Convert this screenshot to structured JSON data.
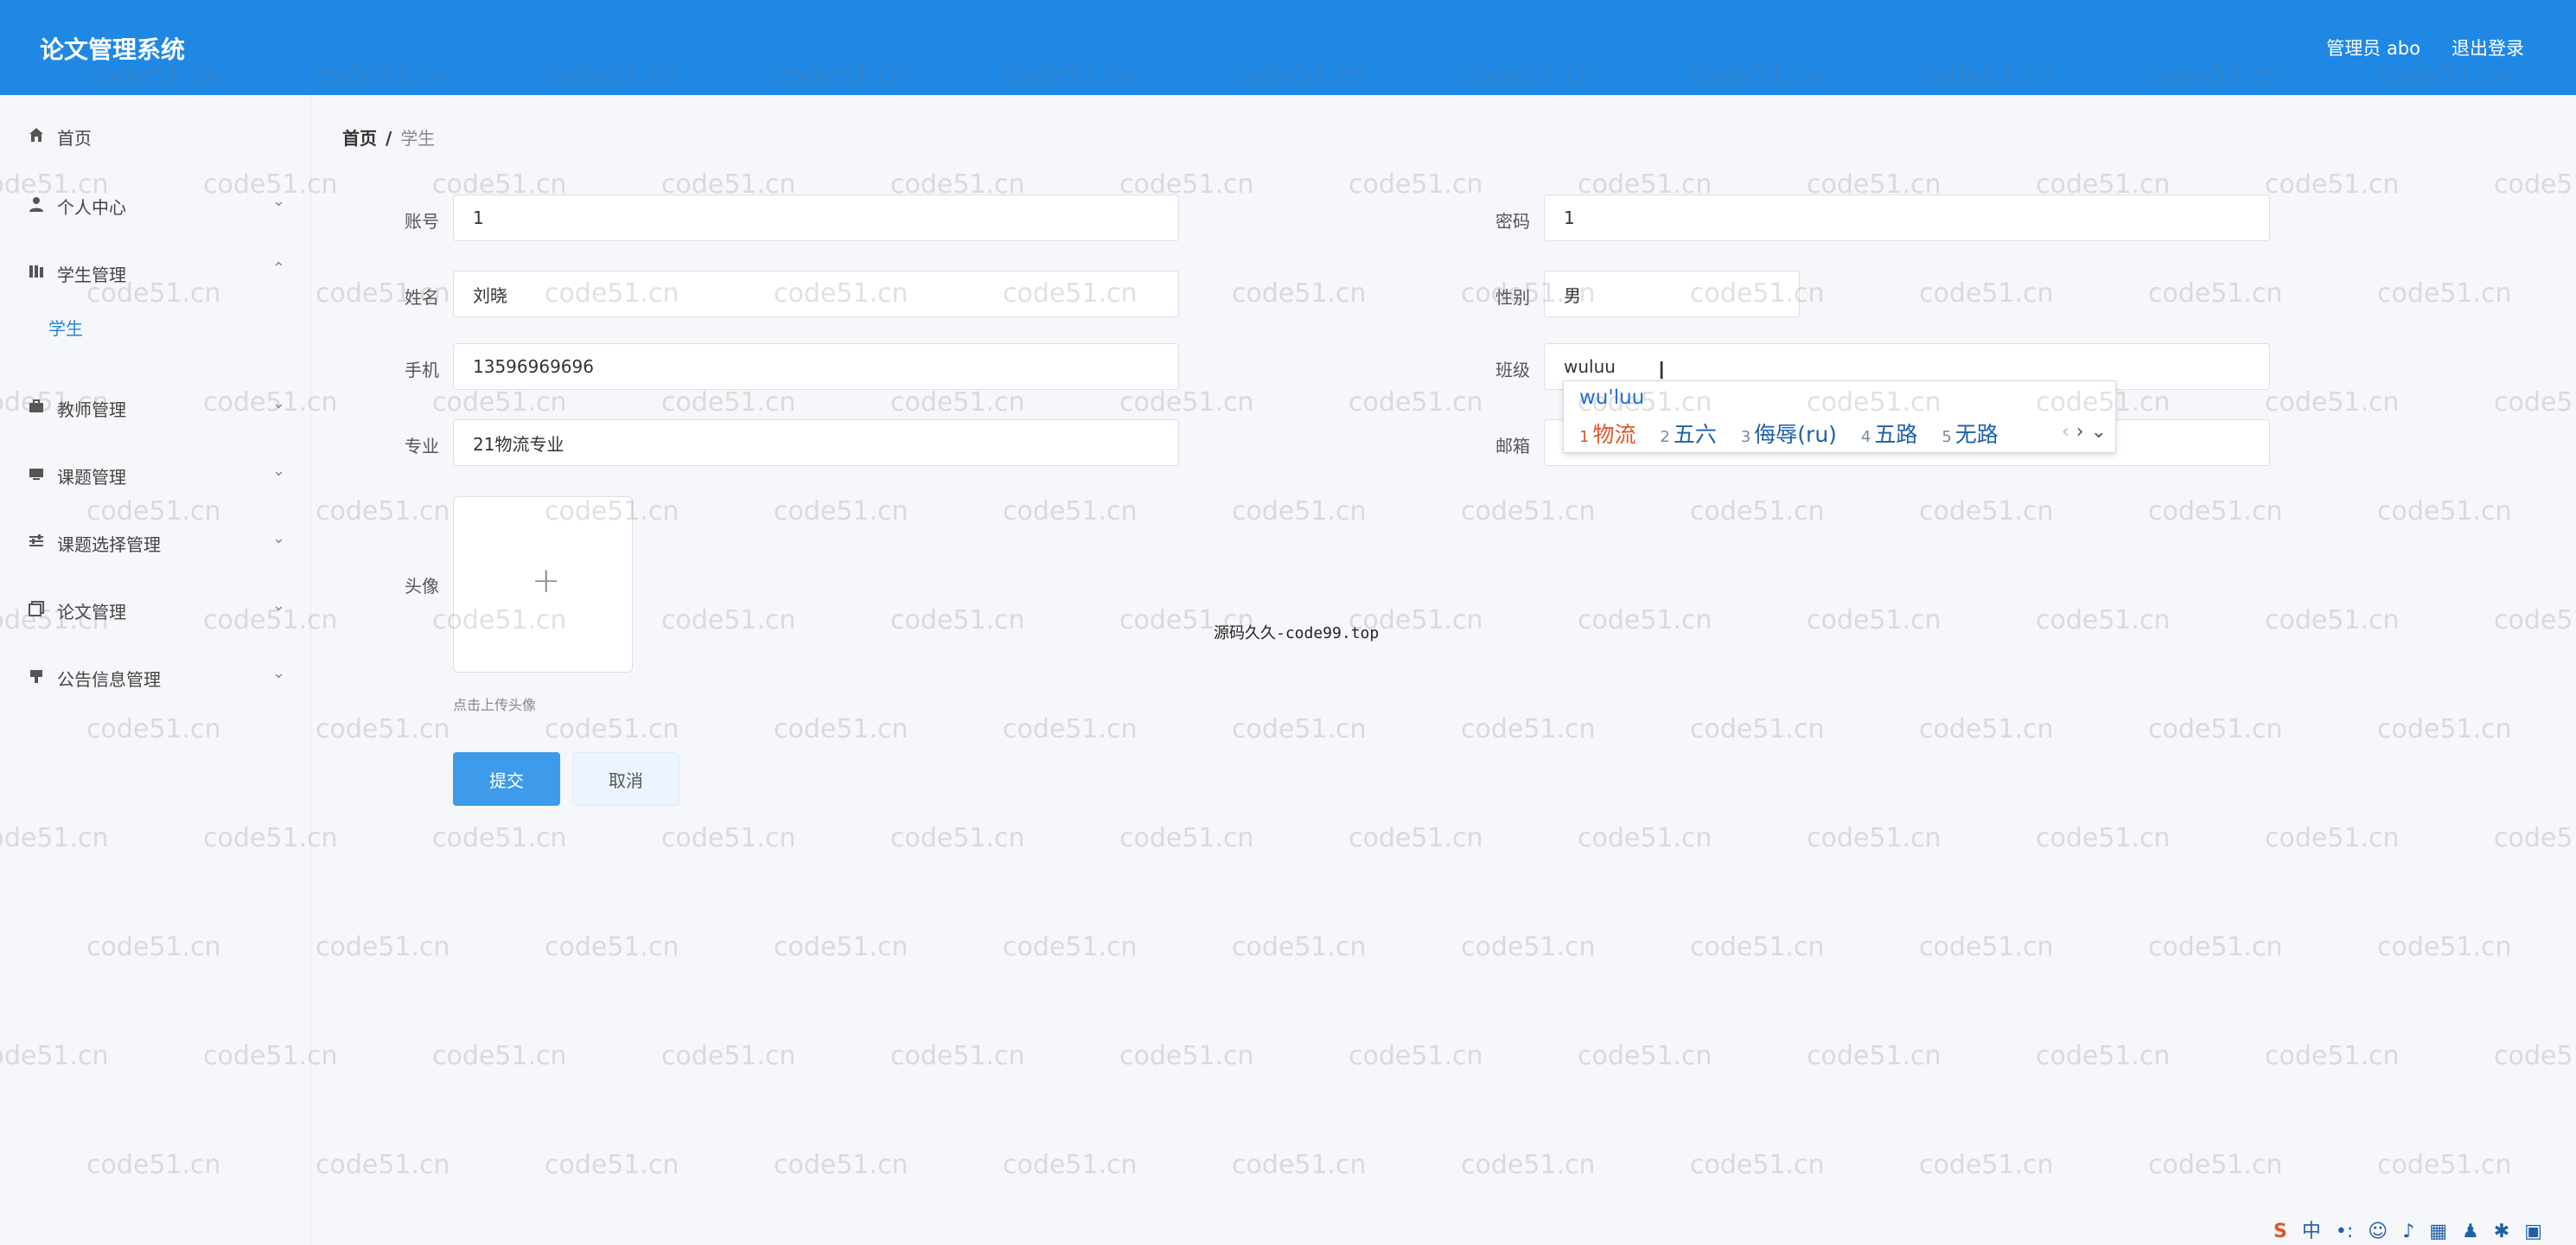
{
  "header": {
    "app_title": "论文管理系统",
    "user_label": "管理员 abo",
    "logout_label": "退出登录"
  },
  "sidebar": {
    "items": [
      {
        "label": "首页",
        "icon": "home-icon"
      },
      {
        "label": "个人中心",
        "icon": "user-icon"
      },
      {
        "label": "学生管理",
        "icon": "book-icon"
      },
      {
        "label": "教师管理",
        "icon": "briefcase-icon"
      },
      {
        "label": "课题管理",
        "icon": "folder-icon"
      },
      {
        "label": "课题选择管理",
        "icon": "sliders-icon"
      },
      {
        "label": "论文管理",
        "icon": "copy-icon"
      },
      {
        "label": "公告信息管理",
        "icon": "megaphone-icon"
      }
    ],
    "sub_item_student": "学生"
  },
  "breadcrumb": {
    "home": "首页",
    "separator": "/",
    "current": "学生"
  },
  "form": {
    "account": {
      "label": "账号",
      "value": "1"
    },
    "password": {
      "label": "密码",
      "value": "1"
    },
    "name": {
      "label": "姓名",
      "value": "刘晓"
    },
    "gender": {
      "label": "性别",
      "value": "男"
    },
    "phone": {
      "label": "手机",
      "value": "13596969696"
    },
    "class": {
      "label": "班级",
      "value": "wuluu"
    },
    "major": {
      "label": "专业",
      "value": "21物流专业"
    },
    "email": {
      "label": "邮箱",
      "value": ""
    },
    "avatar": {
      "label": "头像",
      "hint": "点击上传头像"
    },
    "submit_label": "提交",
    "cancel_label": "取消"
  },
  "center_text": "源码久久-code99.top",
  "ime": {
    "pinyin": "wu'luu",
    "candidates": [
      {
        "n": "1",
        "text": "物流"
      },
      {
        "n": "2",
        "text": "五六"
      },
      {
        "n": "3",
        "text": "侮辱(ru)"
      },
      {
        "n": "4",
        "text": "五路"
      },
      {
        "n": "5",
        "text": "无路"
      }
    ]
  },
  "tray": {
    "ime_lang": "中"
  },
  "watermark": "code51.cn",
  "colors": {
    "header": "#1f88e5",
    "accent": "#1f88e5",
    "submit": "#3d9be9"
  }
}
